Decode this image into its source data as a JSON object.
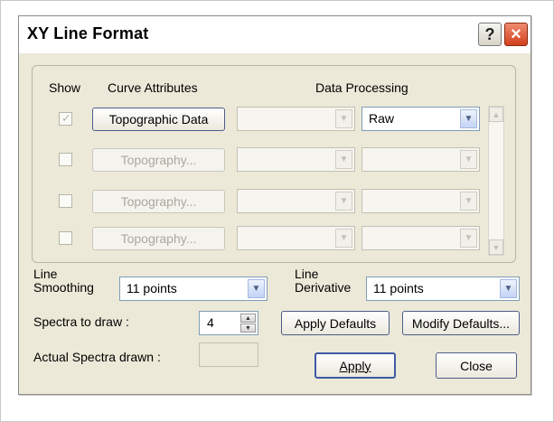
{
  "window": {
    "title": "XY Line Format",
    "help_label": "?",
    "close_label": "×"
  },
  "group": {
    "headers": {
      "show": "Show",
      "curve_attributes": "Curve Attributes",
      "data_processing": "Data Processing"
    },
    "rows": [
      {
        "checked": true,
        "enabled": true,
        "curve_label": "Topographic Data",
        "processing_value": "Raw"
      },
      {
        "checked": false,
        "enabled": false,
        "curve_label": "Topography...",
        "processing_value": ""
      },
      {
        "checked": false,
        "enabled": false,
        "curve_label": "Topography...",
        "processing_value": ""
      },
      {
        "checked": false,
        "enabled": false,
        "curve_label": "Topography...",
        "processing_value": ""
      }
    ]
  },
  "smoothing": {
    "label_line1": "Line",
    "label_line2": "Smoothing",
    "value": "11 points"
  },
  "derivative": {
    "label_line1": "Line",
    "label_line2": "Derivative",
    "value": "11 points"
  },
  "spectra": {
    "label": "Spectra to draw :",
    "value": "4"
  },
  "actual": {
    "label": "Actual Spectra drawn :",
    "value": ""
  },
  "buttons": {
    "apply_defaults": "Apply Defaults",
    "modify_defaults": "Modify Defaults...",
    "apply": "Apply",
    "close": "Close"
  },
  "colors": {
    "dialog_bg": "#ece9d8",
    "close_button": "#d2401d",
    "focus_border": "#3f5aa5"
  }
}
